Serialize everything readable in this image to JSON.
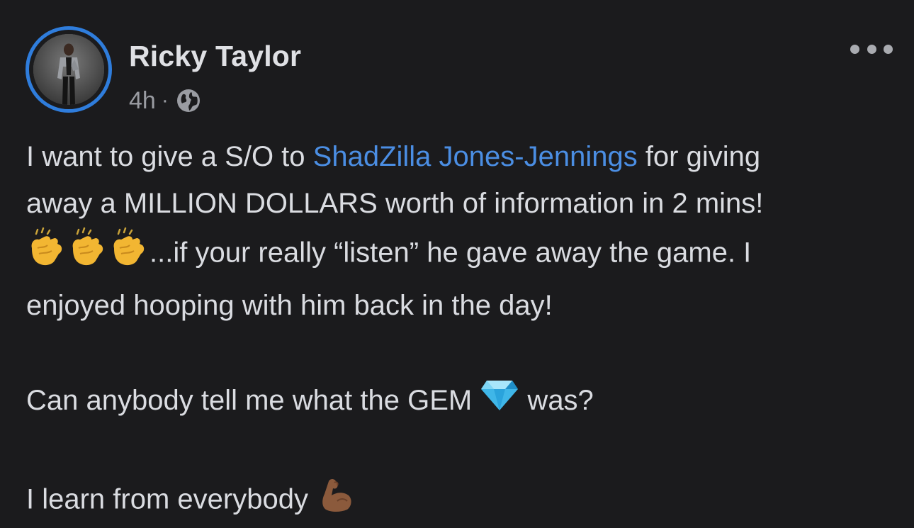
{
  "post": {
    "author": "Ricky Taylor",
    "time": "4h",
    "separator": "·",
    "audience_icon": "globe-icon",
    "more_icon": "more-options-icon",
    "colors": {
      "background": "#1b1b1d",
      "text": "#dadce1",
      "meta": "#9a9ca2",
      "mention": "#4b8ee3",
      "story_ring": "#2f7ddc"
    },
    "lines": {
      "l1_before": "I want to give a S/O to ",
      "l1_mention": "ShadZilla Jones-Jennings",
      "l1_after": " for giving",
      "l2": "away a MILLION DOLLARS worth of information in 2 mins!",
      "l3_emojis": [
        "clapping-hands-emoji",
        "clapping-hands-emoji",
        "clapping-hands-emoji"
      ],
      "l3": "...if your really “listen” he gave away the game. I",
      "l4": "enjoyed hooping with him back in the day!",
      "l5_before": "Can anybody tell me what the GEM ",
      "l5_emoji": "gem-stone-emoji",
      "l5_after": " was?",
      "l6": "I learn from everybody ",
      "l6_emoji": "flexed-biceps-emoji"
    }
  }
}
